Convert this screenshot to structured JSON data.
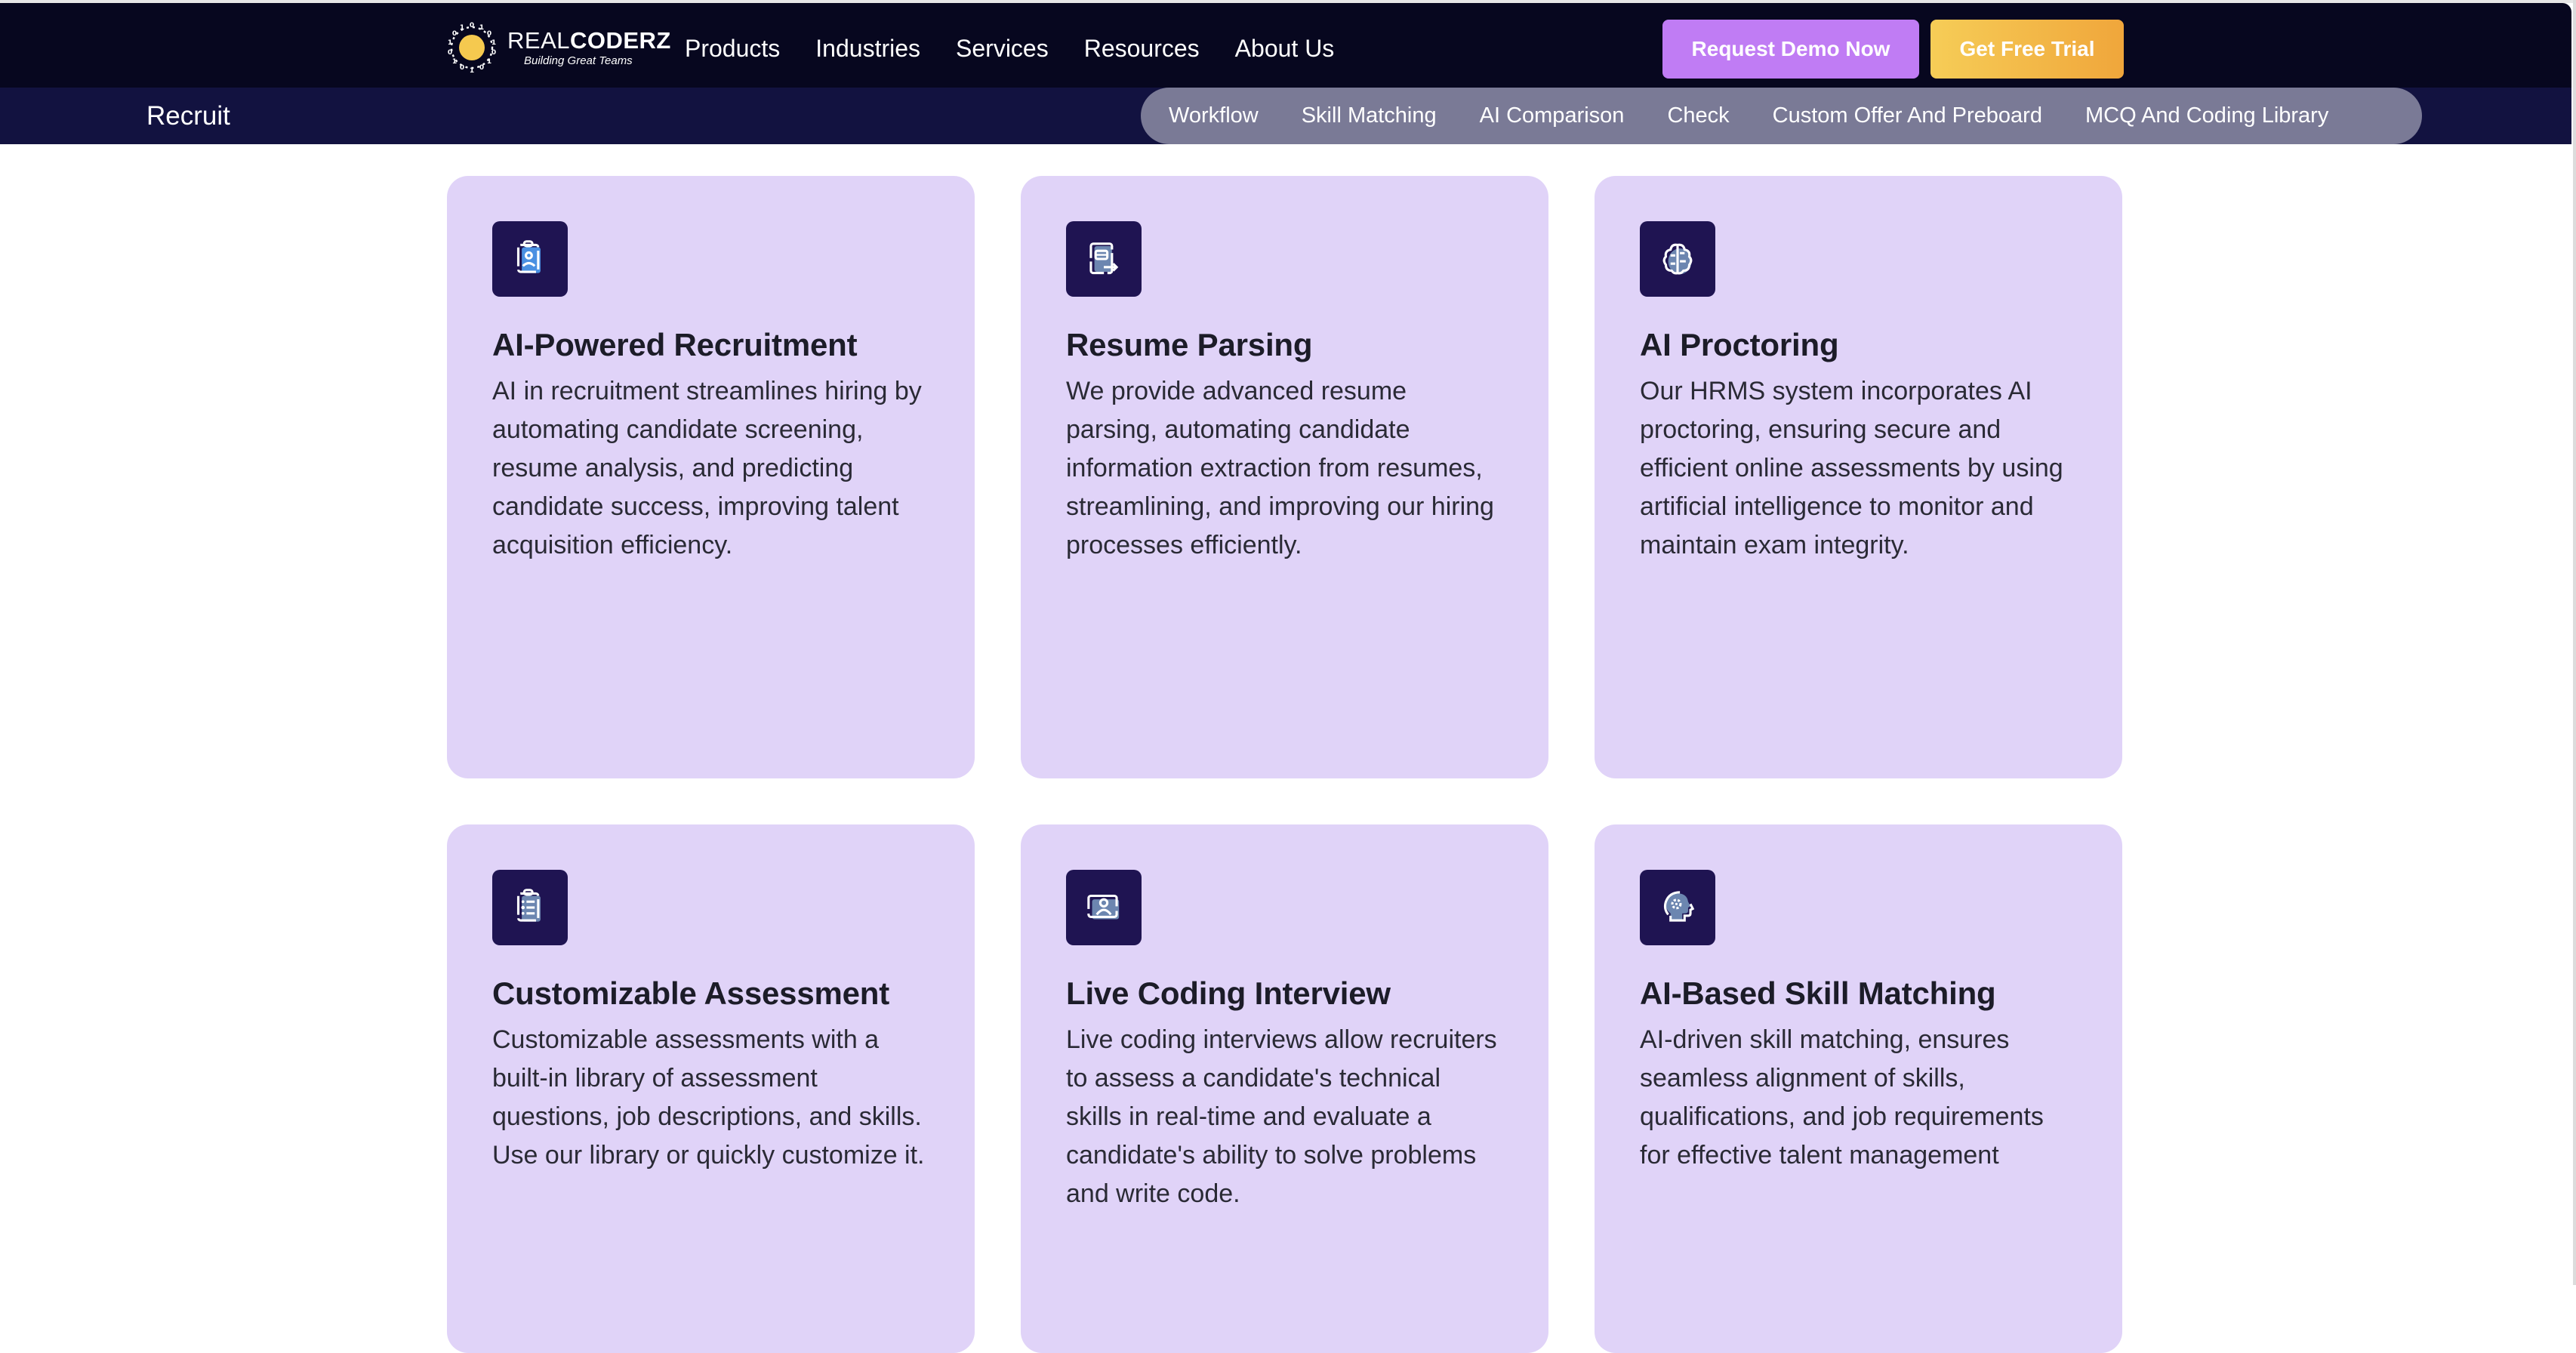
{
  "brand": {
    "name_light": "REAL",
    "name_bold": "CODERZ",
    "tagline": "Building Great Teams",
    "colors": {
      "header_bg": "#07071f",
      "subnav_bg": "#121240",
      "pill_bg": "#7a7a96",
      "card_bg": "#e0d3f8",
      "icon_bg": "#1f1452",
      "demo_btn": "#c07cf4",
      "trial_btn_start": "#f6cd57",
      "trial_btn_end": "#f0a63b"
    }
  },
  "nav": {
    "items": [
      {
        "label": "Products"
      },
      {
        "label": "Industries"
      },
      {
        "label": "Services"
      },
      {
        "label": "Resources"
      },
      {
        "label": "About Us"
      }
    ],
    "request_demo_label": "Request Demo Now",
    "free_trial_label": "Get Free Trial"
  },
  "subnav": {
    "title": "Recruit",
    "items": [
      {
        "label": "Workflow"
      },
      {
        "label": "Skill Matching"
      },
      {
        "label": "AI Comparison"
      },
      {
        "label": "Check"
      },
      {
        "label": "Custom Offer And Preboard"
      },
      {
        "label": "MCQ And Coding Library"
      }
    ]
  },
  "cards": [
    {
      "icon": "clipboard-user-icon",
      "title": "AI-Powered Recruitment",
      "body": "AI in recruitment streamlines hiring by automating candidate screening, resume analysis, and predicting candidate success, improving talent acquisition efficiency."
    },
    {
      "icon": "resume-export-icon",
      "title": "Resume Parsing",
      "body": "We provide advanced resume parsing, automating candidate information extraction from resumes, streamlining, and improving our hiring processes efficiently."
    },
    {
      "icon": "brain-circuit-icon",
      "title": "AI Proctoring",
      "body": "Our HRMS system incorporates AI proctoring, ensuring secure and efficient online assessments by using artificial intelligence to monitor and maintain exam integrity."
    },
    {
      "icon": "clipboard-list-icon",
      "title": "Customizable Assessment",
      "body": "Customizable assessments with a built-in library of assessment questions, job descriptions, and skills. Use our library or quickly customize it."
    },
    {
      "icon": "video-user-icon",
      "title": "Live Coding Interview",
      "body": "Live coding interviews allow recruiters to assess a candidate's technical skills in real-time and evaluate a candidate's ability to solve problems and write code."
    },
    {
      "icon": "head-gear-icon",
      "title": "AI-Based Skill Matching",
      "body": "AI-driven skill matching, ensures seamless alignment of skills, qualifications, and job requirements for effective talent management"
    }
  ]
}
